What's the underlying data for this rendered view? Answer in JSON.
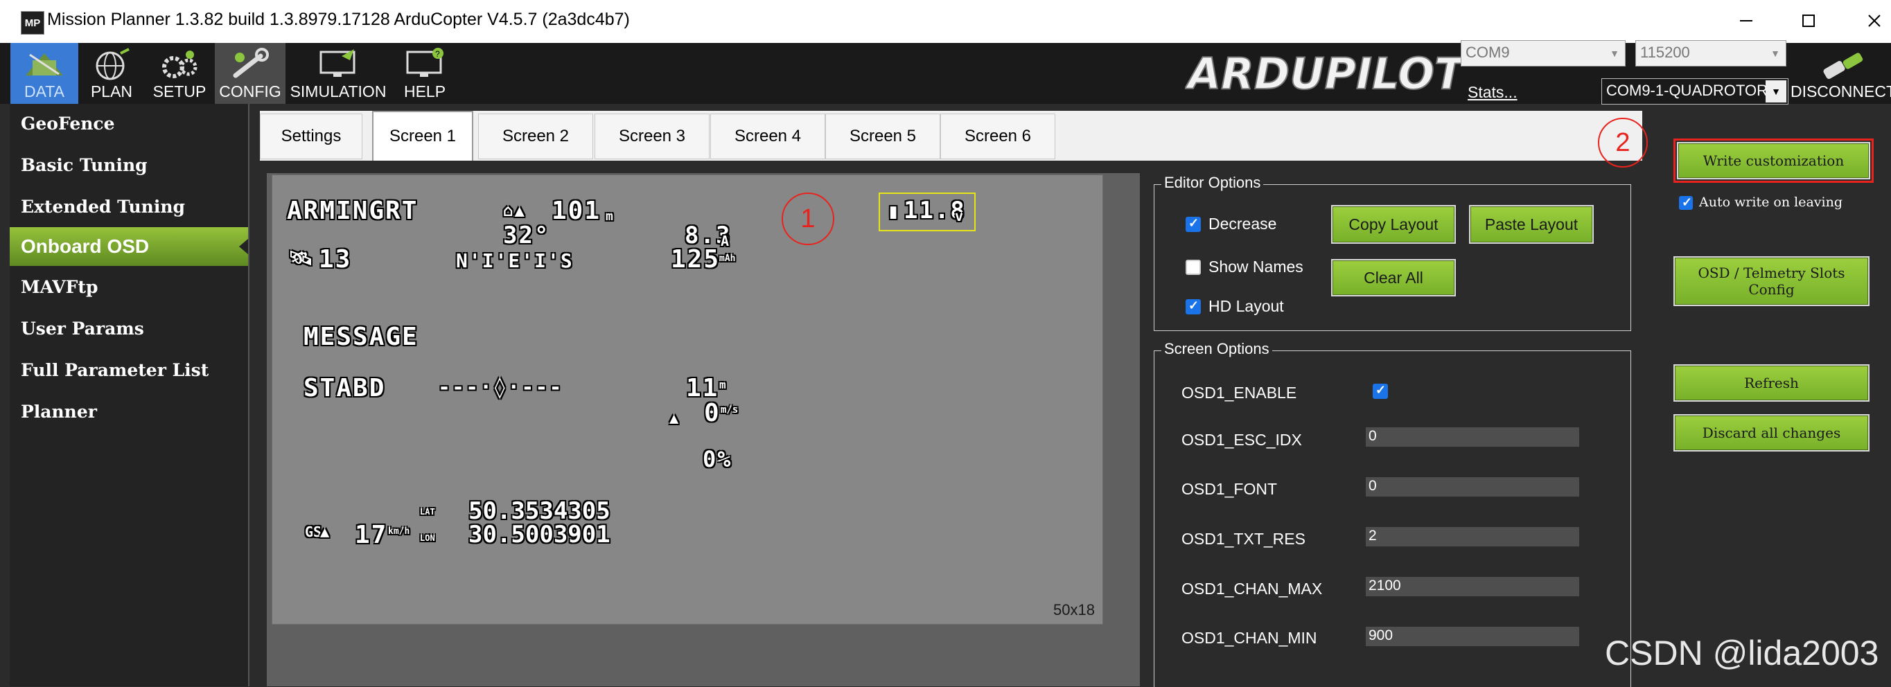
{
  "window": {
    "app_icon": "MP",
    "title": "Mission Planner 1.3.82 build 1.3.8979.17128 ArduCopter V4.5.7 (2a3dc4b7)",
    "controls": [
      "minimize-icon",
      "maximize-icon",
      "close-icon"
    ]
  },
  "menu": [
    {
      "label": "DATA",
      "icon": "data-icon"
    },
    {
      "label": "PLAN",
      "icon": "plan-globe-icon"
    },
    {
      "label": "SETUP",
      "icon": "setup-gears-icon"
    },
    {
      "label": "CONFIG",
      "icon": "config-wrench-icon"
    },
    {
      "label": "SIMULATION",
      "icon": "simulation-monitor-icon"
    },
    {
      "label": "HELP",
      "icon": "help-monitor-icon"
    }
  ],
  "logo": "ARDUPILOT",
  "connection": {
    "port": "COM9",
    "baud": "115200",
    "stats_label": "Stats...",
    "vehicle": "COM9-1-QUADROTOR",
    "disconnect_label": "DISCONNECT"
  },
  "sidebar": {
    "items": [
      {
        "label": "GeoFence"
      },
      {
        "label": "Basic Tuning"
      },
      {
        "label": "Extended Tuning"
      },
      {
        "label": "Onboard OSD",
        "active": true
      },
      {
        "label": "MAVFtp"
      },
      {
        "label": "User Params"
      },
      {
        "label": "Full Parameter List"
      },
      {
        "label": "Planner"
      }
    ]
  },
  "tabs": [
    "Settings",
    "Screen 1",
    "Screen 2",
    "Screen 3",
    "Screen 4",
    "Screen 5",
    "Screen 6"
  ],
  "active_tab": "Screen 1",
  "osd": {
    "arming": "ARMINGRT",
    "home_dist": "101",
    "home_unit": "m",
    "temp": "32°",
    "current": "8.3",
    "current_unit": "A",
    "consumed": "125",
    "consumed_unit": "mAh",
    "sats": "13",
    "compass": "N'I'E'I'S",
    "battery": "11.8",
    "battery_unit": "v",
    "message": "MESSAGE",
    "mode": "STABD",
    "horizon": "---·◊·---",
    "alt": "11",
    "alt_unit": "m",
    "vspeed": "0",
    "vspeed_unit": "m/s",
    "throttle": "0%",
    "gs_label": "GS",
    "groundspeed": "17",
    "gs_unit": "km/h",
    "lat_label": "LAT",
    "lat": "50.3534305",
    "lon_label": "LON",
    "lon": "30.5003901",
    "grid_size": "50x18"
  },
  "annotations": {
    "one": "1",
    "two": "2"
  },
  "editor_options": {
    "title": "Editor Options",
    "decrease": {
      "label": "Decrease",
      "checked": true
    },
    "show_names": {
      "label": "Show Names",
      "checked": false
    },
    "hd_layout": {
      "label": "HD Layout",
      "checked": true
    },
    "copy_layout": "Copy Layout",
    "paste_layout": "Paste Layout",
    "clear_all": "Clear All"
  },
  "screen_options": {
    "title": "Screen Options",
    "enable_label": "OSD1_ENABLE",
    "enable_checked": true,
    "params": [
      {
        "name": "OSD1_ESC_IDX",
        "value": "0"
      },
      {
        "name": "OSD1_FONT",
        "value": "0"
      },
      {
        "name": "OSD1_TXT_RES",
        "value": "2"
      },
      {
        "name": "OSD1_CHAN_MAX",
        "value": "2100"
      },
      {
        "name": "OSD1_CHAN_MIN",
        "value": "900"
      }
    ]
  },
  "right_panel": {
    "write_customization": "Write customization",
    "auto_write": {
      "label": "Auto write on leaving",
      "checked": true
    },
    "osd_slots": "OSD / Telmetry Slots Config",
    "refresh": "Refresh",
    "discard": "Discard all changes"
  },
  "colors": {
    "accent_green": "#8cc63f",
    "annotation_red": "#e8231d",
    "checkbox_blue": "#1a73e8",
    "battery_frame": "#e5e51a"
  },
  "watermark": "CSDN @lida2003"
}
